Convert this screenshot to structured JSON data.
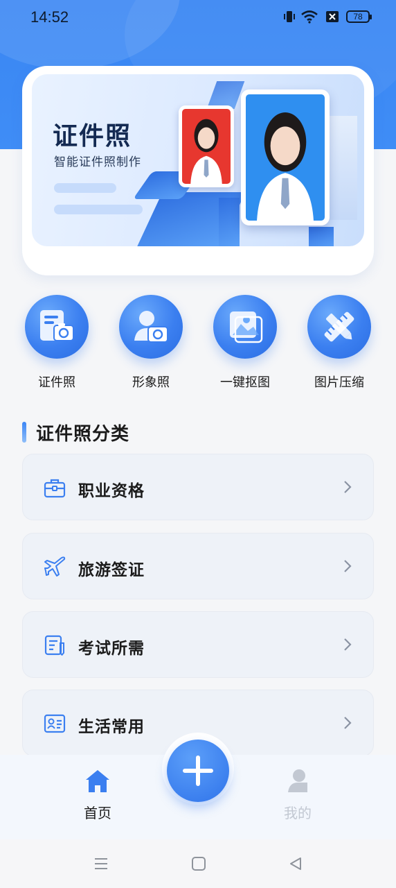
{
  "status_bar": {
    "time": "14:52",
    "battery": "78"
  },
  "banner": {
    "title": "证件照",
    "subtitle": "智能证件照制作"
  },
  "features": [
    {
      "label": "证件照",
      "icon": "id-photo-camera-icon"
    },
    {
      "label": "形象照",
      "icon": "portrait-camera-icon"
    },
    {
      "label": "一键抠图",
      "icon": "image-cutout-icon"
    },
    {
      "label": "图片压缩",
      "icon": "image-compress-icon"
    }
  ],
  "section": {
    "title": "证件照分类"
  },
  "categories": [
    {
      "label": "职业资格",
      "icon": "briefcase-icon"
    },
    {
      "label": "旅游签证",
      "icon": "airplane-icon"
    },
    {
      "label": "考试所需",
      "icon": "exam-paper-icon"
    },
    {
      "label": "生活常用",
      "icon": "id-card-icon"
    }
  ],
  "tabbar": {
    "home_label": "首页",
    "mine_label": "我的"
  },
  "colors": {
    "accent": "#3b7ff0",
    "active_tab": "#3b7ff0",
    "inactive_tab": "#c2c8d2"
  }
}
